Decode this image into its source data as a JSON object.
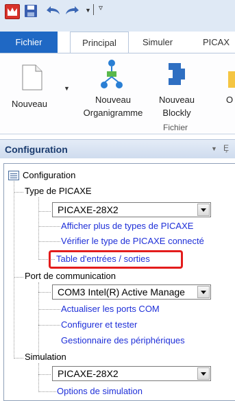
{
  "ribbon_tabs": {
    "file": "Fichier",
    "principal": "Principal",
    "simuler": "Simuler",
    "picaxe": "PICAX"
  },
  "ribbon": {
    "nouveau": "Nouveau",
    "organigramme_line1": "Nouveau",
    "organigramme_line2": "Organigramme",
    "blockly_line1": "Nouveau",
    "blockly_line2": "Blockly",
    "cut_label": "O",
    "group_label": "Fichier"
  },
  "panel": {
    "title": "Configuration",
    "pin": "Ȩ"
  },
  "tree": {
    "root": "Configuration",
    "type_group": "Type de PICAXE",
    "type_select": "PICAXE-28X2",
    "link_more_types": "Afficher plus de types de PICAXE",
    "link_verify": "Vérifier le type de PICAXE connecté",
    "link_io_table": "Table d'entrées / sorties",
    "port_group": "Port de communication",
    "port_select": "COM3 Intel(R) Active Manage",
    "link_refresh_com": "Actualiser les ports COM",
    "link_config_test": "Configurer et tester",
    "link_device_mgr": "Gestionnaire des périphériques",
    "sim_group": "Simulation",
    "sim_select": "PICAXE-28X2",
    "link_sim_options": "Options de simulation"
  },
  "colors": {
    "file_tab": "#1f68c4",
    "link": "#1e2fd8",
    "highlight": "#e31c1c"
  }
}
